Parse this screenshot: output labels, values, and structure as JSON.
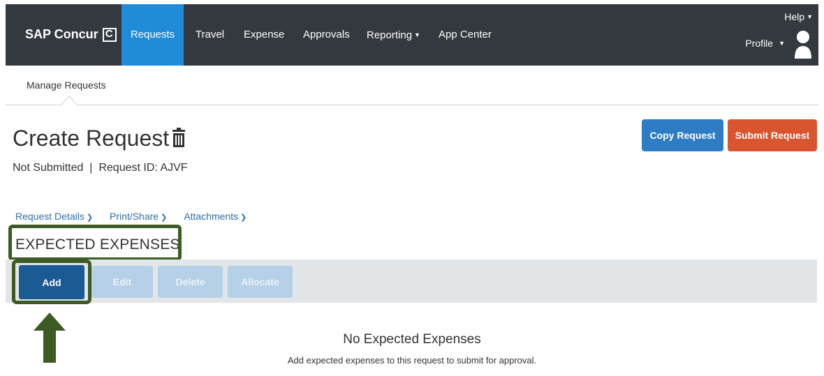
{
  "brand": {
    "name": "SAP Concur"
  },
  "nav": {
    "items": [
      {
        "label": "Requests",
        "active": true
      },
      {
        "label": "Travel"
      },
      {
        "label": "Expense"
      },
      {
        "label": "Approvals"
      },
      {
        "label": "Reporting"
      },
      {
        "label": "App Center"
      }
    ],
    "help": "Help",
    "profile": "Profile"
  },
  "subnav": {
    "item": "Manage Requests"
  },
  "header": {
    "title": "Create Request",
    "status": "Not Submitted",
    "request_id_label": "Request ID: AJVF",
    "copy_button": "Copy Request",
    "submit_button": "Submit Request"
  },
  "tabs": [
    {
      "label": "Request Details"
    },
    {
      "label": "Print/Share"
    },
    {
      "label": "Attachments"
    }
  ],
  "section": {
    "title": "EXPECTED EXPENSES",
    "actions": {
      "add": "Add",
      "edit": "Edit",
      "delete": "Delete",
      "allocate": "Allocate"
    }
  },
  "empty_state": {
    "title": "No Expected Expenses",
    "message": "Add expected expenses to this request to submit for approval."
  },
  "colors": {
    "nav_bg": "#34393f",
    "nav_active": "#1f8bd9",
    "copy_button": "#2e7cc4",
    "submit_button": "#d95530",
    "add_button": "#1c5a93",
    "highlight": "#3c5a22"
  }
}
